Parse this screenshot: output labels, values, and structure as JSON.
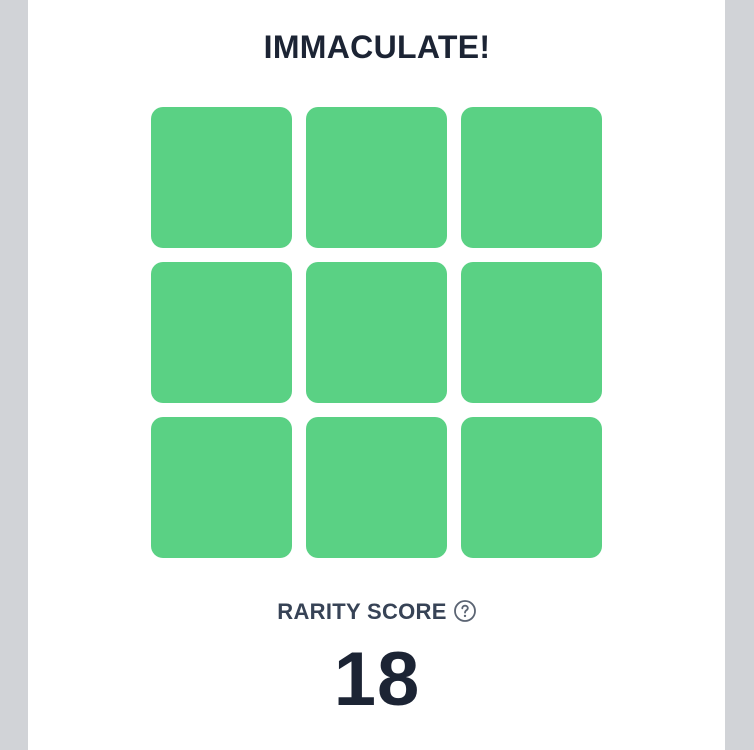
{
  "result": {
    "title": "IMMACULATE!"
  },
  "grid": {
    "rows": 3,
    "cols": 3,
    "cells": [
      {
        "status": "correct"
      },
      {
        "status": "correct"
      },
      {
        "status": "correct"
      },
      {
        "status": "correct"
      },
      {
        "status": "correct"
      },
      {
        "status": "correct"
      },
      {
        "status": "correct"
      },
      {
        "status": "correct"
      },
      {
        "status": "correct"
      }
    ],
    "correct_color": "#5ad184"
  },
  "rarity": {
    "label": "RARITY SCORE",
    "help_icon": "question-circle-icon",
    "score": "18"
  },
  "colors": {
    "text_dark": "#1c2434",
    "text_label": "#374356",
    "background_side": "#d1d3d7",
    "panel": "#ffffff"
  }
}
